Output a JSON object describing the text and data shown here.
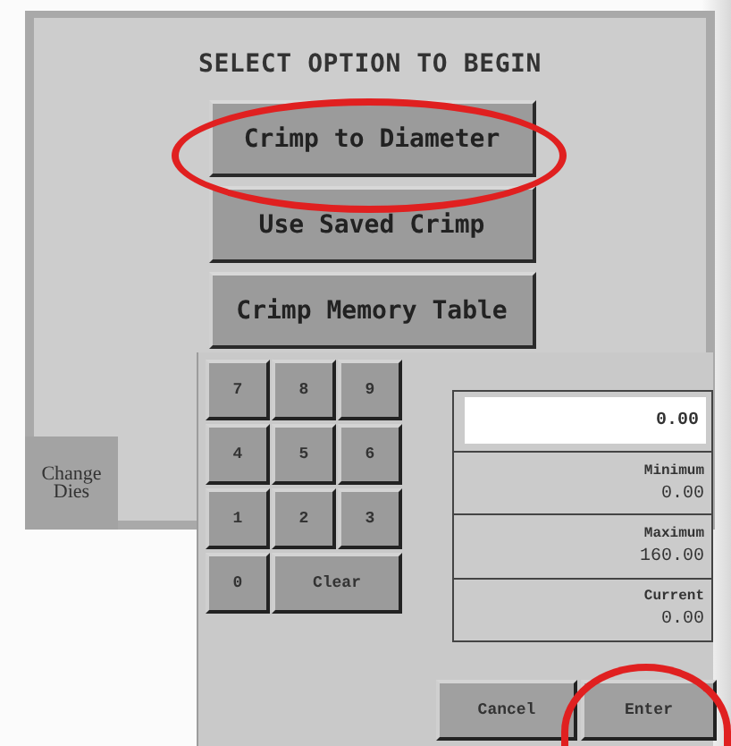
{
  "screen": {
    "title": "SELECT OPTION TO BEGIN",
    "options": [
      {
        "label": "Crimp to Diameter",
        "highlighted": true
      },
      {
        "label": "Use Saved Crimp",
        "highlighted": false
      },
      {
        "label": "Crimp Memory Table",
        "highlighted": false
      }
    ],
    "side_button": "Change Dies"
  },
  "keypad": {
    "keys": [
      {
        "label": "7",
        "kind": "digit"
      },
      {
        "label": "8",
        "kind": "digit"
      },
      {
        "label": "9",
        "kind": "digit"
      },
      {
        "label": "4",
        "kind": "digit"
      },
      {
        "label": "5",
        "kind": "digit"
      },
      {
        "label": "6",
        "kind": "digit"
      },
      {
        "label": "1",
        "kind": "digit"
      },
      {
        "label": "2",
        "kind": "digit"
      },
      {
        "label": "3",
        "kind": "digit"
      },
      {
        "label": "0",
        "kind": "digit"
      },
      {
        "label": "Clear",
        "kind": "wide"
      }
    ],
    "entry": {
      "value": "0.00"
    },
    "limits": [
      {
        "label": "Minimum",
        "value": "0.00"
      },
      {
        "label": "Maximum",
        "value": "160.00"
      },
      {
        "label": "Current",
        "value": "0.00"
      }
    ],
    "buttons": [
      {
        "label": "Cancel",
        "highlighted": false
      },
      {
        "label": "Enter",
        "highlighted": true
      }
    ]
  }
}
